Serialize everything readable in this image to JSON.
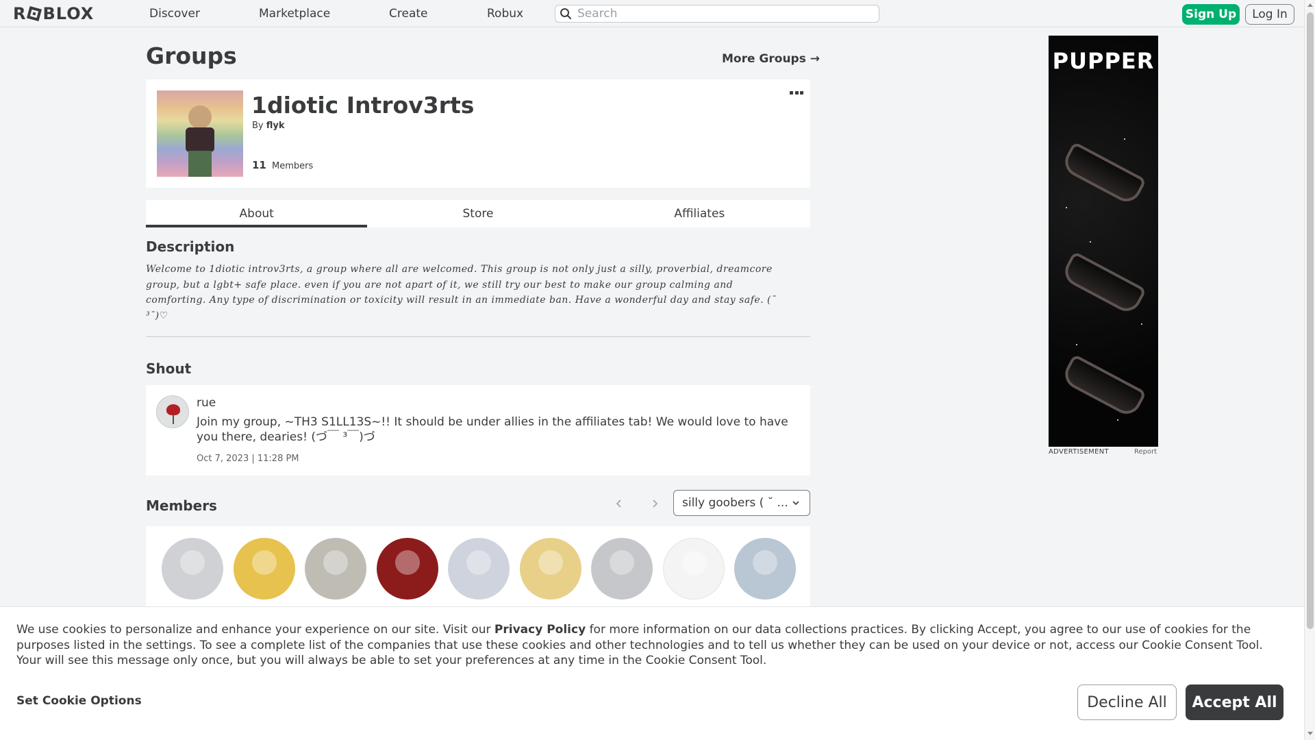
{
  "topnav": {
    "logo_text": "ROBLOX",
    "links": [
      "Discover",
      "Marketplace",
      "Create",
      "Robux"
    ],
    "search_placeholder": "Search",
    "signup_label": "Sign Up",
    "login_label": "Log In"
  },
  "page": {
    "title": "Groups",
    "more_groups": "More Groups →"
  },
  "group": {
    "name": "1diotic Introv3rts",
    "by_label": "By",
    "owner": "flyk",
    "member_count": "11",
    "members_label": "Members"
  },
  "tabs": [
    "About",
    "Store",
    "Affiliates"
  ],
  "about": {
    "description_title": "Description",
    "description": "Welcome to 1diotic introv3rts, a group where all are welcomed. This group is not only just a silly, proverbial, dreamcore group, but a lgbt+ safe place. even if you are not apart of it, we still try our best to make our group calming and comforting. Any type of discrimination or toxicity will result in an immediate ban. Have a wonderful day and stay safe. (¯ ³¯)♡"
  },
  "shout": {
    "title": "Shout",
    "user": "rue",
    "text": "Join my group, ~TH3 S1LL13S~!! It should be under allies in the affiliates tab! We would love to have you there, dearies! (づ￣ ³￣)づ",
    "date": "Oct 7, 2023 | 11:28 PM"
  },
  "members": {
    "title": "Members",
    "role_selected": "silly goobers ( ˘ ...",
    "avatar_colors": [
      "#cfd1d4",
      "#e7c24e",
      "#bfbcb4",
      "#8c1c1c",
      "#cfd3de",
      "#e8d089",
      "#c5c7ca",
      "#f4f4f4",
      "#b9c6d3"
    ]
  },
  "ad": {
    "brand": "PUPPER",
    "label": "ADVERTISEMENT",
    "report": "Report"
  },
  "cookie": {
    "text_before": "We use cookies to personalize and enhance your experience on our site. Visit our ",
    "link": "Privacy Policy",
    "text_after": " for more information on our data collections practices. By clicking Accept, you agree to our use of cookies for the purposes listed in the settings. To see a complete list of the companies that use these cookies and other technologies and to tell us whether they can be used on your device or not, access our Cookie Consent Tool. Your will see this message only once, but you will always be able to set your preferences at any time in the Cookie Consent Tool.",
    "set_options": "Set Cookie Options",
    "decline": "Decline All",
    "accept": "Accept All"
  }
}
